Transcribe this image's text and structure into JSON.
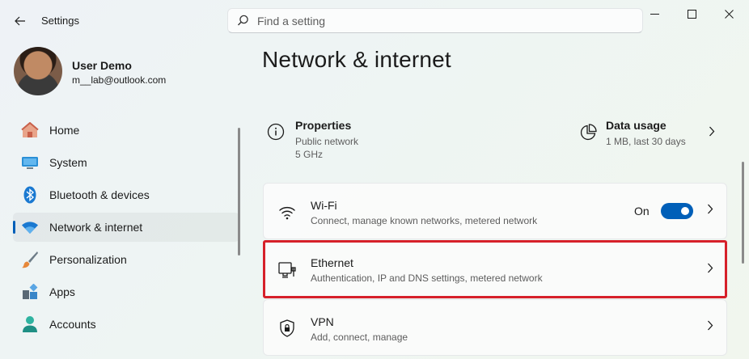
{
  "titlebar": {
    "app_title": "Settings",
    "search_placeholder": "Find a setting"
  },
  "user": {
    "name": "User Demo",
    "email": "m__lab@outlook.com"
  },
  "sidebar": {
    "items": [
      {
        "label": "Home",
        "icon": "home-icon",
        "selected": false
      },
      {
        "label": "System",
        "icon": "system-icon",
        "selected": false
      },
      {
        "label": "Bluetooth & devices",
        "icon": "bluetooth-icon",
        "selected": false
      },
      {
        "label": "Network & internet",
        "icon": "wifi-icon",
        "selected": true
      },
      {
        "label": "Personalization",
        "icon": "brush-icon",
        "selected": false
      },
      {
        "label": "Apps",
        "icon": "apps-icon",
        "selected": false
      },
      {
        "label": "Accounts",
        "icon": "accounts-icon",
        "selected": false
      }
    ]
  },
  "main": {
    "page_title": "Network & internet",
    "properties": {
      "title": "Properties",
      "line1": "Public network",
      "line2": "5 GHz",
      "icon": "info-icon"
    },
    "data_usage": {
      "title": "Data usage",
      "subtitle": "1 MB, last 30 days",
      "icon": "data-usage-icon"
    },
    "cards": {
      "wifi": {
        "title": "Wi-Fi",
        "subtitle": "Connect, manage known networks, metered network",
        "toggle_label": "On",
        "toggle_on": true,
        "icon": "wifi-signal-icon"
      },
      "ethernet": {
        "title": "Ethernet",
        "subtitle": "Authentication, IP and DNS settings, metered network",
        "icon": "ethernet-icon"
      },
      "vpn": {
        "title": "VPN",
        "subtitle": "Add, connect, manage",
        "icon": "shield-icon"
      }
    }
  },
  "colors": {
    "accent": "#005fb8",
    "highlight": "#d6202a"
  }
}
